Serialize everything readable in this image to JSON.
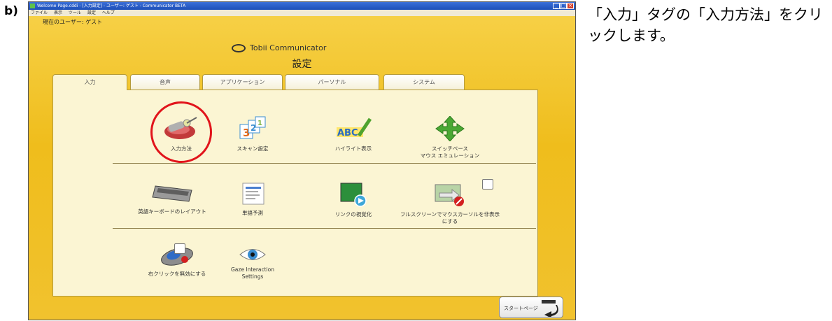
{
  "step_label": "b)",
  "instruction": "「入力」タグの「入力方法」をクリックします。",
  "window": {
    "title": "Welcome Page.cddi - [入力設定] - ユーザー: ゲスト - Communicator BETA",
    "menu": [
      "ファイル",
      "表示",
      "ツール",
      "設定",
      "ヘルプ"
    ],
    "current_user": "現在のユーザー: ゲスト",
    "brand": "Tobii Communicator",
    "page_title": "設定"
  },
  "tabs": [
    "入力",
    "音声",
    "アプリケーション",
    "パーソナル",
    "システム"
  ],
  "active_tab": "入力",
  "items": {
    "row1": [
      "入力方法",
      "スキャン設定",
      "ハイライト表示",
      "スイッチベース\nマウス エミュレーション"
    ],
    "row2": [
      "英語キーボードのレイアウト",
      "単語予測",
      "リンクの視覚化",
      "フルスクリーンでマウスカーソルを非表示にする"
    ],
    "row3": [
      "右クリックを無効にする",
      "Gaze Interaction\nSettings"
    ]
  },
  "start_button": "スタートページ",
  "icons": [
    "pen-input-icon",
    "scan-settings-icon",
    "highlight-abc-icon",
    "move-arrows-icon",
    "keyboard-icon",
    "word-prediction-icon",
    "link-visualize-icon",
    "hide-cursor-icon",
    "mouse-icon",
    "eye-icon",
    "tobii-logo-icon",
    "start-arrow-icon"
  ],
  "colors": {
    "highlight": "#e1141b",
    "window_bg": "#efbd1c",
    "panel_bg": "#fbf5d3"
  }
}
